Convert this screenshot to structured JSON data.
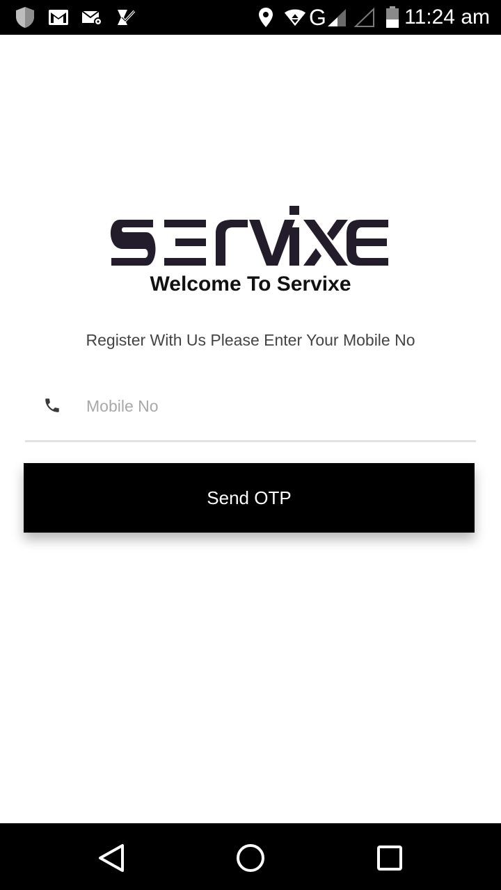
{
  "status_bar": {
    "network_letter": "G",
    "time": "11:24 am",
    "icons": [
      "shield-icon",
      "gmail-icon",
      "mail-settings-icon",
      "check-task-icon",
      "location-icon",
      "wifi-icon",
      "signal-icon",
      "signal-empty-icon",
      "battery-icon"
    ]
  },
  "brand": {
    "logo_text": "servixe",
    "color": "#231c2b"
  },
  "welcome": {
    "title": "Welcome To Servixe",
    "subtitle": "Register With Us Please Enter Your Mobile No"
  },
  "form": {
    "mobile_placeholder": "Mobile No",
    "mobile_value": "",
    "phone_icon": "phone-icon",
    "send_button_label": "Send OTP"
  },
  "nav_bar": {
    "icons": [
      "back-triangle-icon",
      "home-circle-icon",
      "recents-square-icon"
    ]
  }
}
